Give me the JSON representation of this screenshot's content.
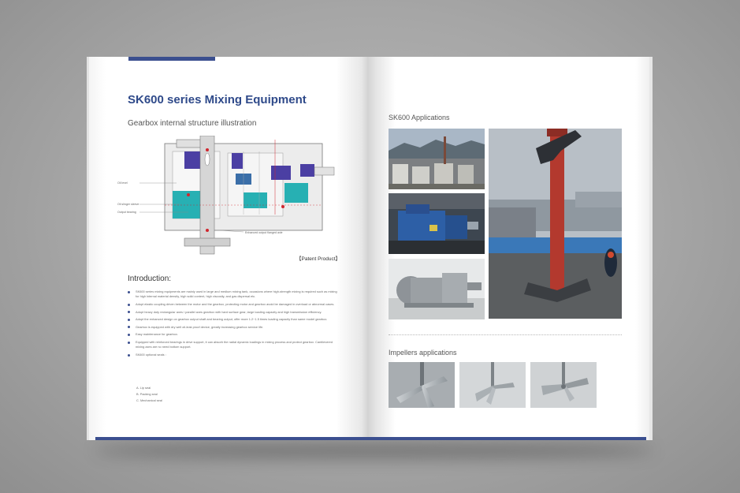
{
  "left_page": {
    "title": "SK600 series Mixing Equipment",
    "subtitle": "Gearbox internal structure illustration",
    "diagram_labels": {
      "oil_level": "Oil level",
      "oil_slinger": "Oil slinger sleeve",
      "output_bearing": "Output bearing",
      "output_shaft": "Enhanced output flanged axle"
    },
    "patent": "【Patent Product】",
    "intro_heading": "Introduction:",
    "bullets": [
      "SK600 series mixing equipments are mainly used in large and medium mixing tank, occasions where high-strength mixing is required such as mixing for high internal material density, high solid content, high viscosity, and gas dispersal etc.",
      "Adopt elastic coupling driven between the motor and the gearbox, protecting motor and gearbox avoid be damaged in overload or abnormal cases.",
      "Adopt heavy duty rectangular axes / parallel axes gearbox with hard surface gear, large loading capacity and high transmission efficiency.",
      "Adopt the enhanced design on gearbox output shaft and bearing output, offer more 1.2~1.5 times loading capacity than same model gearbox.",
      "Gearbox is equipped with dry well oil-leak proof device, greatly increasing gearbox service life.",
      "Easy maintenance for gearbox.",
      "Equipped with reinforced bearings in drive support, it can absorb the radial dynamic loadings in mixing process and protect gearbox. Cantilevered mixing axes are no need bottom support.",
      "SK600 optional seals :"
    ],
    "seal_options": [
      "A. Lip seal",
      "B. Packing seal",
      "C. Mechanical seal"
    ]
  },
  "right_page": {
    "applications_heading": "SK600 Applications",
    "impellers_heading": "Impellers applications"
  },
  "colors": {
    "brand_blue": "#3b4f8f",
    "title_blue": "#2f4a8a",
    "teal": "#27b0b3",
    "purple": "#4b3fa3"
  }
}
